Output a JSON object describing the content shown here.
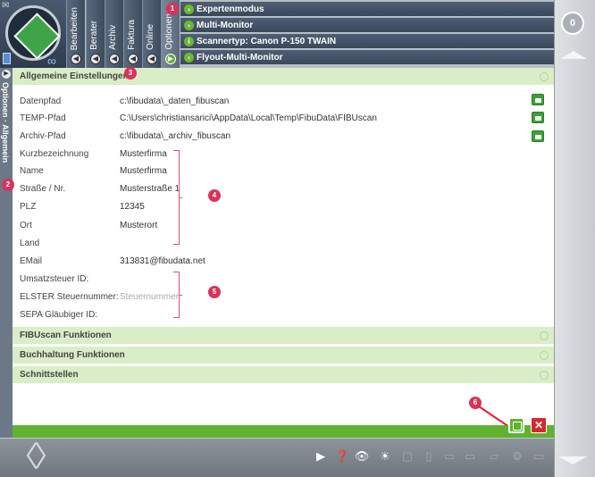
{
  "app": {
    "top_tabs": [
      {
        "label": "Bearbeiten"
      },
      {
        "label": "Berater"
      },
      {
        "label": "Archiv"
      },
      {
        "label": "Faktura"
      },
      {
        "label": "Online"
      },
      {
        "label": "Optionen"
      }
    ],
    "options_rows": [
      {
        "label": "Expertenmodus",
        "icon": "arrow-right-icon",
        "badge": "1"
      },
      {
        "label": "Multi-Monitor",
        "icon": "arrow-right-icon"
      },
      {
        "label": "Scannertyp: Canon P-150 TWAIN",
        "icon": "info-icon"
      },
      {
        "label": "Flyout-Multi-Monitor",
        "icon": "arrow-left-icon"
      }
    ],
    "counter": "0",
    "side_tab_label": "Optionen · Allgemein",
    "badges": {
      "b1": "1",
      "b2": "2",
      "b3": "3",
      "b4": "4",
      "b5": "5",
      "b6": "6"
    }
  },
  "sections": {
    "general": "Allgemeine Einstellungen",
    "fibuscan": "FIBUscan Funktionen",
    "accounting": "Buchhaltung Funktionen",
    "interfaces": "Schnittstellen"
  },
  "fields": [
    {
      "label": "Datenpfad",
      "value": "c:\\fibudata\\_daten_fibuscan",
      "folder": true
    },
    {
      "label": "TEMP-Pfad",
      "value": "C:\\Users\\christiansarici\\AppData\\Local\\Temp\\FibuData\\FIBUscan",
      "folder": true
    },
    {
      "label": "Archiv-Pfad",
      "value": "c:\\fibudata\\_archiv_fibuscan",
      "folder": true
    },
    {
      "label": "Kurzbezeichnung",
      "value": "Musterfirma"
    },
    {
      "label": "Name",
      "value": "Musterfirma"
    },
    {
      "label": "Straße / Nr.",
      "value": "Musterstraße 1"
    },
    {
      "label": "PLZ",
      "value": "12345"
    },
    {
      "label": "Ort",
      "value": "Musterort"
    },
    {
      "label": "Land",
      "value": ""
    },
    {
      "label": "EMail",
      "value": "313831@fibudata.net"
    },
    {
      "label": "Umsatzsteuer ID:",
      "value": ""
    },
    {
      "label": "ELSTER Steuernummer:",
      "value": "",
      "placeholder": "Steuernummer"
    },
    {
      "label": "SEPA Gläubiger ID:",
      "value": ""
    }
  ],
  "colors": {
    "accent_green": "#5fb330",
    "header_green": "#d9eec7",
    "badge_red": "#d8335a",
    "close_red": "#d6282d"
  }
}
